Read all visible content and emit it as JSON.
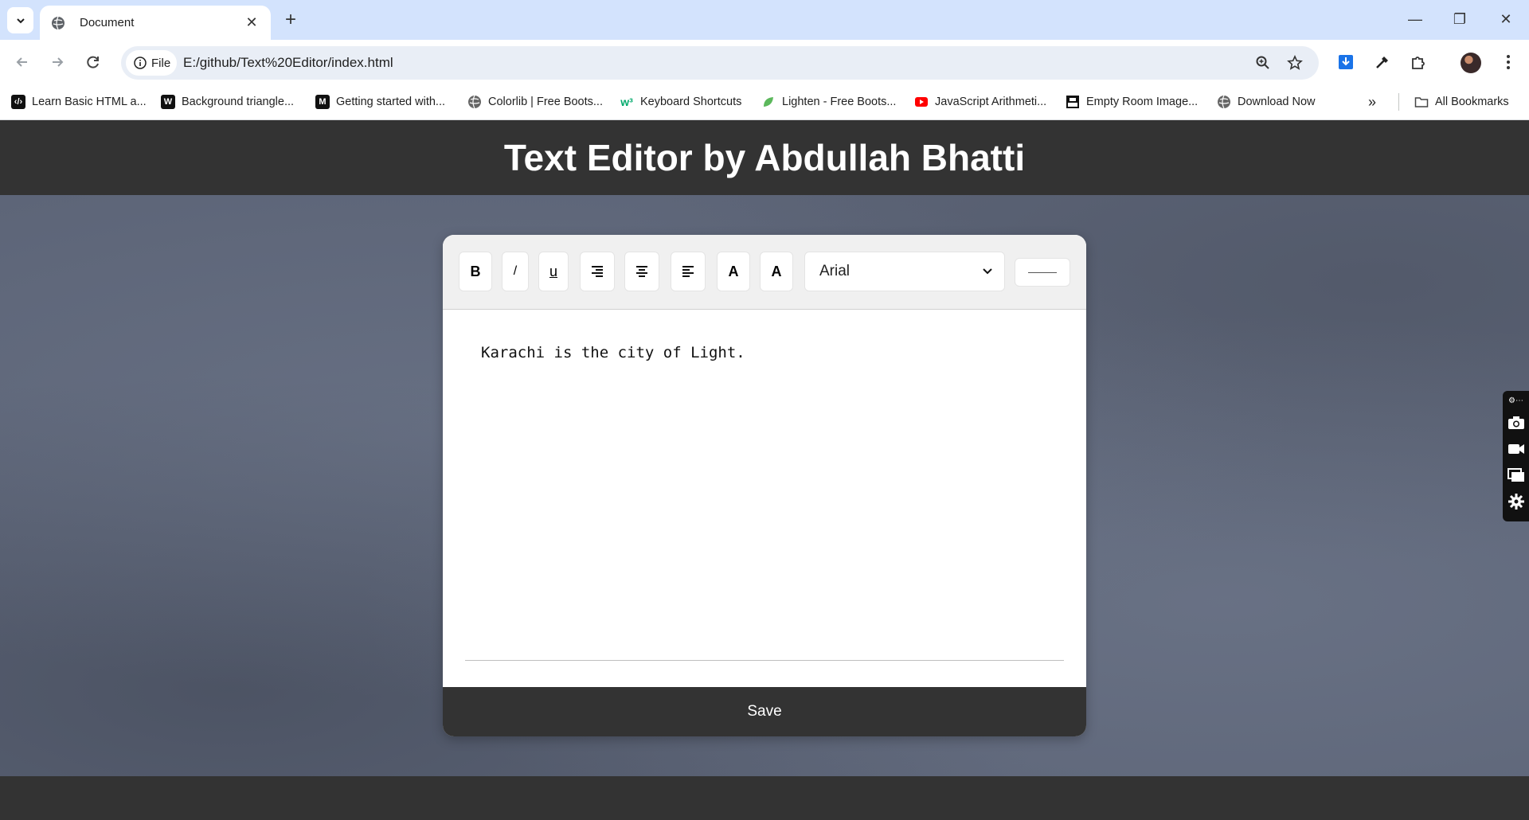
{
  "browser": {
    "tab_title": "Document",
    "url_chip": "File",
    "url": "E:/github/Text%20Editor/index.html",
    "bookmarks": [
      {
        "label": "Learn Basic HTML a...",
        "icon": "code-icon",
        "color": "#111111"
      },
      {
        "label": "Background triangle...",
        "icon": "w-logo-icon",
        "color": "#111111"
      },
      {
        "label": "Getting started with...",
        "icon": "m-logo-icon",
        "color": "#111111"
      },
      {
        "label": "Colorlib | Free Boots...",
        "icon": "globe-icon",
        "color": "#666666"
      },
      {
        "label": "Keyboard Shortcuts",
        "icon": "w3-logo-icon",
        "color": "#04aa6d"
      },
      {
        "label": "Lighten - Free Boots...",
        "icon": "leaf-icon",
        "color": "#5cb85c"
      },
      {
        "label": "JavaScript Arithmeti...",
        "icon": "youtube-icon",
        "color": "#ff0000"
      },
      {
        "label": "Empty Room Image...",
        "icon": "unsplash-icon",
        "color": "#111111"
      },
      {
        "label": "Download Now",
        "icon": "globe-icon",
        "color": "#666666"
      }
    ],
    "all_bookmarks": "All Bookmarks"
  },
  "page": {
    "title": "Text Editor by Abdullah Bhatti"
  },
  "editor": {
    "buttons": {
      "bold": "B",
      "italic": "/",
      "underline": "u",
      "font_color": "A",
      "highlight": "A"
    },
    "font_select": "Arial",
    "content": "Karachi is the city of Light.",
    "save": "Save"
  }
}
